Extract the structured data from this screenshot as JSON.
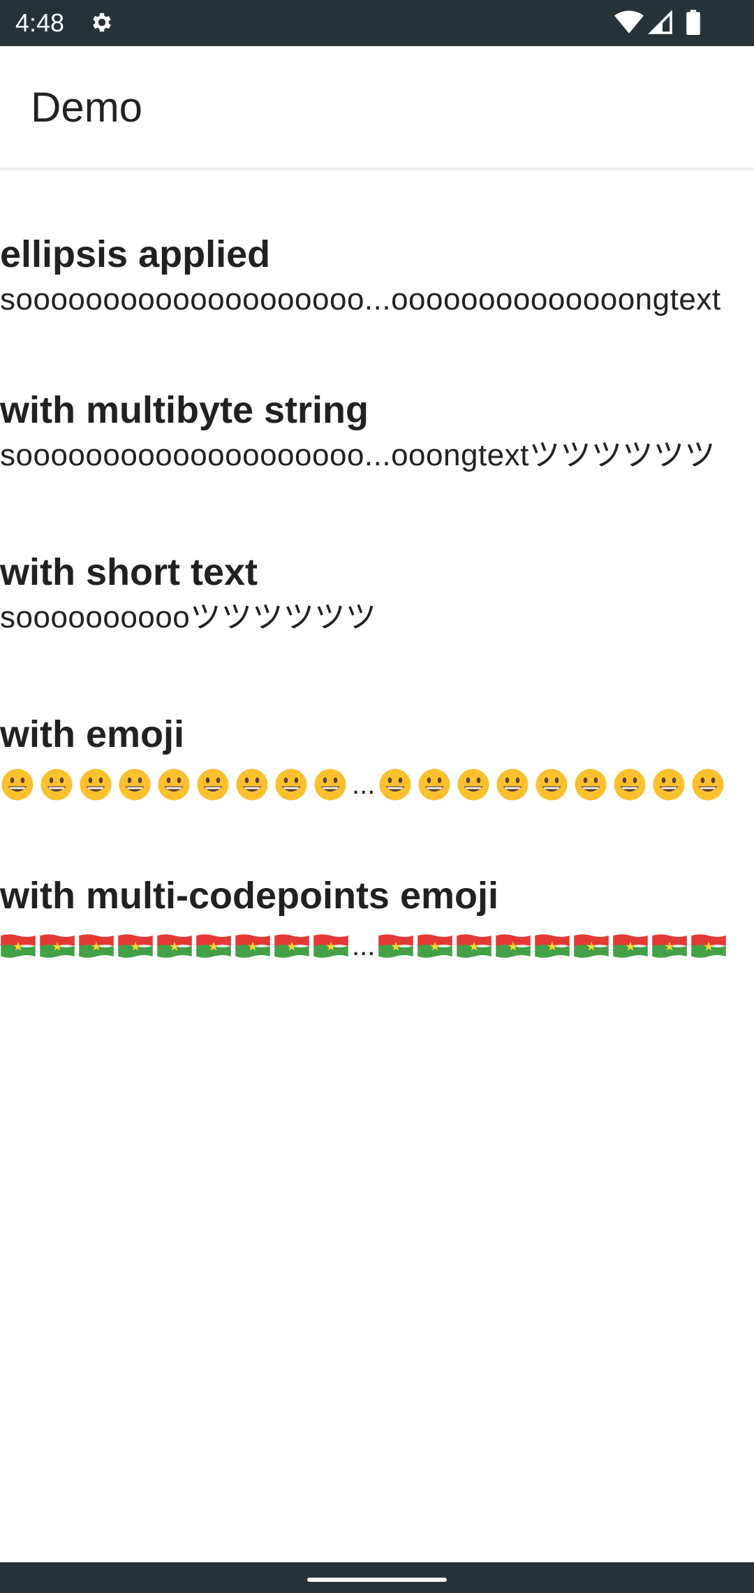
{
  "status_bar": {
    "time": "4:48",
    "icons": [
      "gear-icon",
      "wifi-icon",
      "signal-icon",
      "battery-icon"
    ]
  },
  "app_bar": {
    "title": "Demo"
  },
  "sections": [
    {
      "title": "ellipsis applied",
      "body": "soooooooooooooooooooo...oooooooooooooongtext"
    },
    {
      "title": "with multibyte string",
      "body": "soooooooooooooooooooo...ooongtextツツツツツツ"
    },
    {
      "title": "with short text",
      "body": "sooooooooooツツツツツツ"
    },
    {
      "title": "with emoji",
      "left_count": 9,
      "ellipsis": "...",
      "right_count": 9,
      "icon": "grinning-face-emoji"
    },
    {
      "title": "with multi-codepoints emoji",
      "left_count": 9,
      "ellipsis": "...",
      "right_count": 9,
      "icon": "burkina-faso-flag-emoji"
    }
  ],
  "colors": {
    "status_bar": "#263238",
    "text": "#212121",
    "flag_red": "#e53935",
    "flag_green": "#43a047",
    "flag_star": "#fdd835",
    "smiley_face": "#fbc02d"
  }
}
